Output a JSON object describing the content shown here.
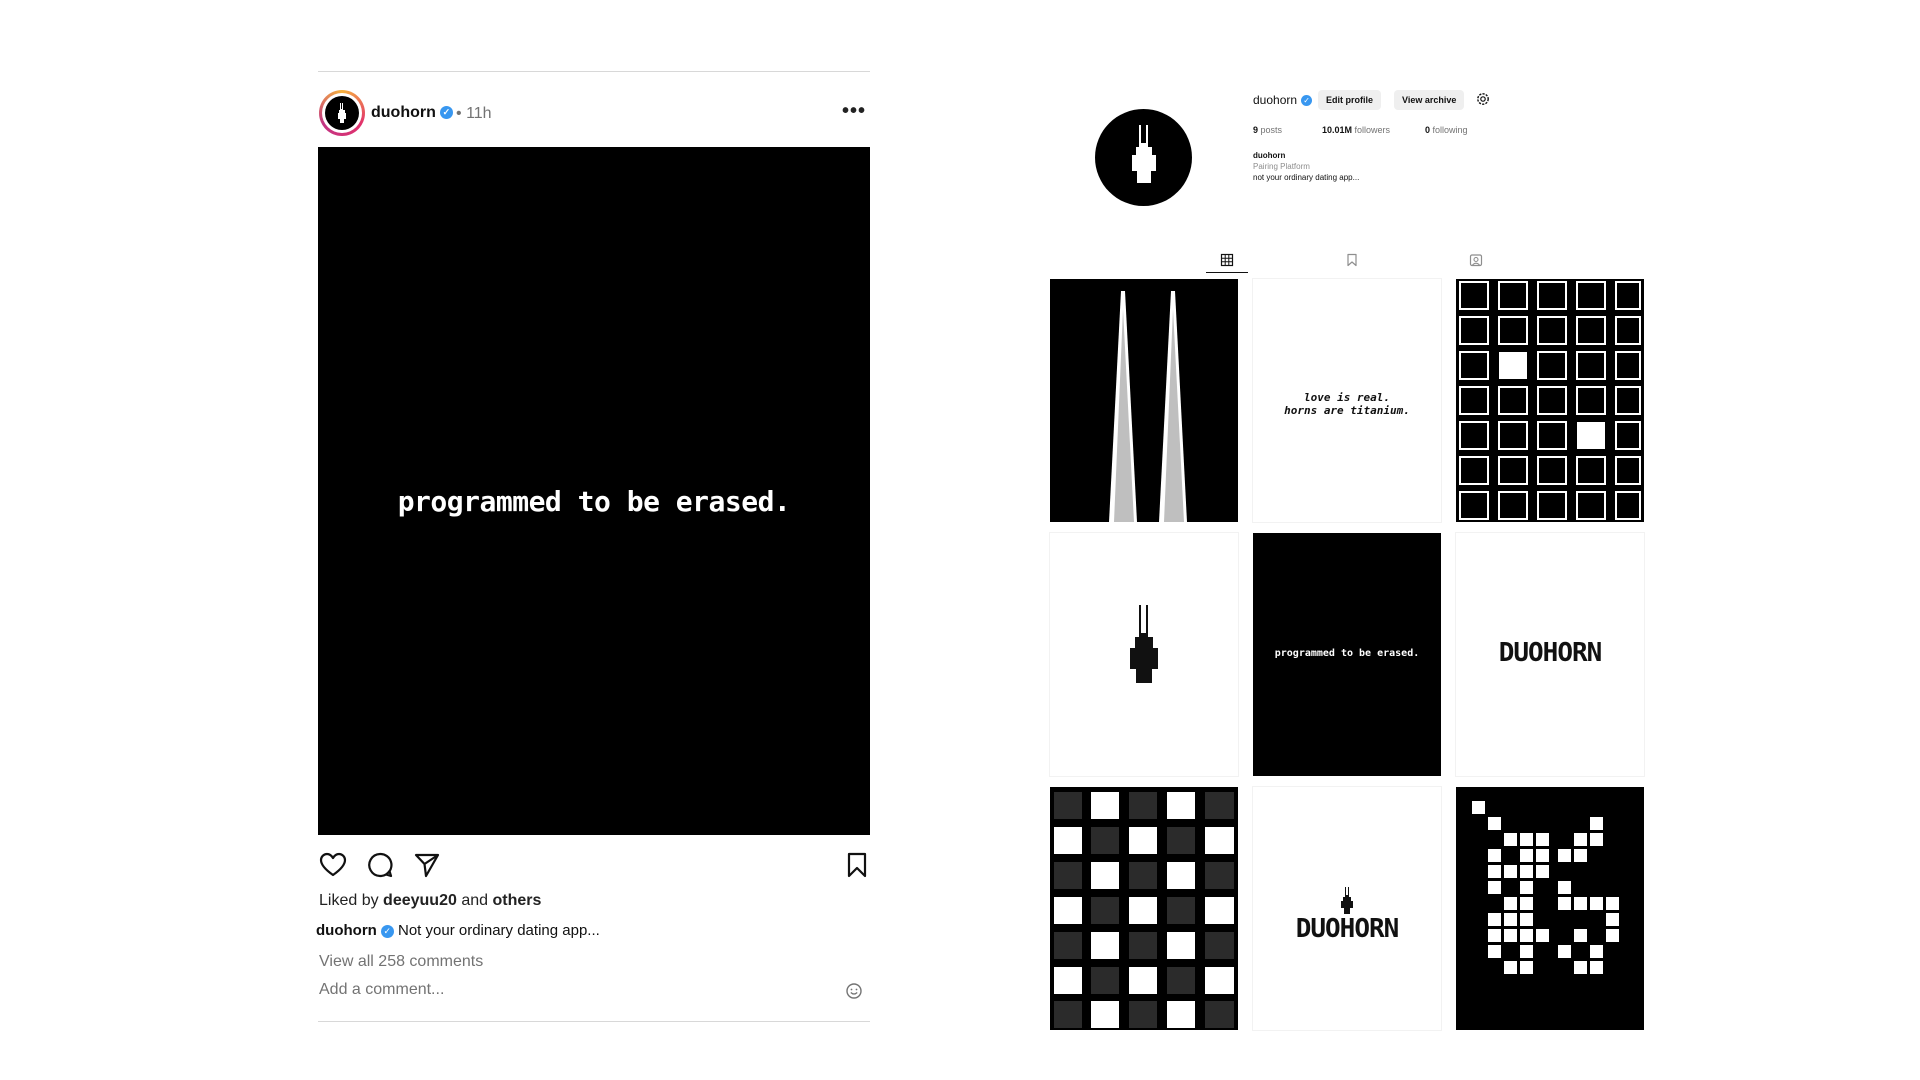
{
  "post": {
    "username": "duohorn",
    "time_separator": "•",
    "time": "11h",
    "more_label": "•••",
    "image_text": "programmed to be erased.",
    "liked_prefix": "Liked by",
    "liked_user": "deeyuu20",
    "liked_and": "and",
    "liked_others": "others",
    "caption_user": "duohorn",
    "caption_text": "Not your ordinary dating app...",
    "view_comments": "View all 258 comments",
    "add_comment_placeholder": "Add a comment...",
    "icons": [
      "heart-icon",
      "comment-icon",
      "share-icon",
      "bookmark-icon",
      "emoji-icon"
    ]
  },
  "profile": {
    "username": "duohorn",
    "edit_profile": "Edit profile",
    "view_archive": "View archive",
    "posts_count": "9",
    "posts_label": "posts",
    "followers_count": "10.01M",
    "followers_label": "followers",
    "following_count": "0",
    "following_label": "following",
    "bio_name": "duohorn",
    "bio_category": "Pairing Platform",
    "bio_text": "not your ordinary dating app...",
    "tabs": [
      "posts-grid-icon",
      "saved-icon",
      "tagged-icon"
    ],
    "grid": {
      "tile_2_line1": "love is real.",
      "tile_2_line2": "horns are titanium.",
      "tile_5_text": "programmed to be erased.",
      "tile_6_text": "DUOHORN",
      "tile_8_text": "DUOHORN"
    }
  },
  "colors": {
    "verified": "#3897f0",
    "muted": "#737373",
    "black": "#000000"
  }
}
